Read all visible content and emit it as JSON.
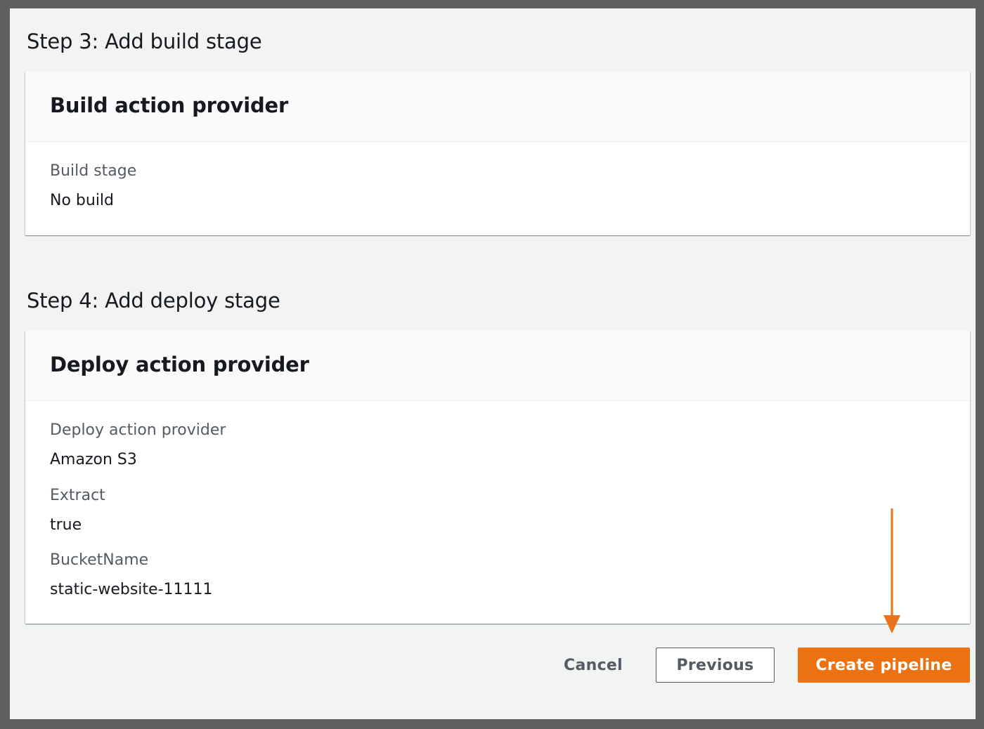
{
  "step3": {
    "title": "Step 3: Add build stage",
    "panel_title": "Build action provider",
    "fields": [
      {
        "label": "Build stage",
        "value": "No build"
      }
    ]
  },
  "step4": {
    "title": "Step 4: Add deploy stage",
    "panel_title": "Deploy action provider",
    "fields": [
      {
        "label": "Deploy action provider",
        "value": "Amazon S3"
      },
      {
        "label": "Extract",
        "value": "true"
      },
      {
        "label": "BucketName",
        "value": "static-website-11111"
      }
    ]
  },
  "actions": {
    "cancel_label": "Cancel",
    "previous_label": "Previous",
    "create_label": "Create pipeline"
  },
  "colors": {
    "primary": "#ec7211",
    "annotation_arrow": "#e8731a"
  },
  "annotation": {
    "icon": "arrow-down-icon"
  }
}
